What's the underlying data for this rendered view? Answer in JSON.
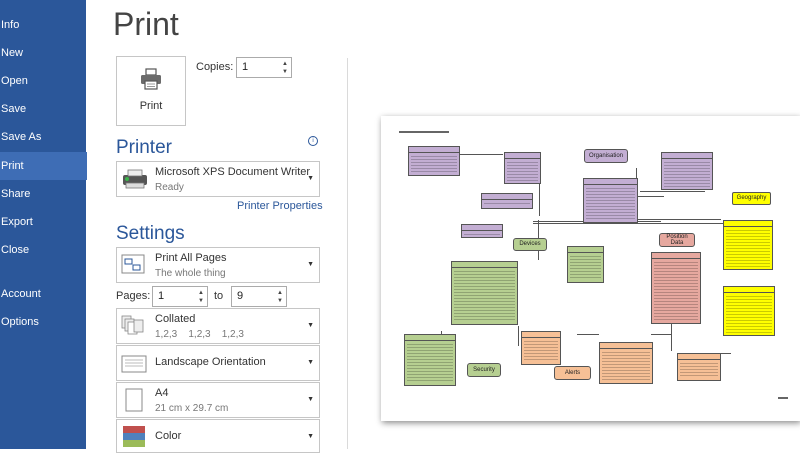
{
  "sidebar": {
    "items": [
      {
        "label": "Info"
      },
      {
        "label": "New"
      },
      {
        "label": "Open"
      },
      {
        "label": "Save"
      },
      {
        "label": "Save As"
      },
      {
        "label": "Print",
        "active": true
      },
      {
        "label": "Share"
      },
      {
        "label": "Export"
      },
      {
        "label": "Close"
      },
      {
        "label": "Account"
      },
      {
        "label": "Options"
      }
    ]
  },
  "page": {
    "title": "Print"
  },
  "print_button": {
    "label": "Print"
  },
  "copies": {
    "label": "Copies:",
    "value": "1"
  },
  "printer": {
    "heading": "Printer",
    "name": "Microsoft XPS Document Writer",
    "status": "Ready",
    "properties_link": "Printer Properties"
  },
  "settings": {
    "heading": "Settings",
    "print_range": {
      "title": "Print All Pages",
      "subtitle": "The whole thing"
    },
    "pages": {
      "label": "Pages:",
      "from": "1",
      "to_label": "to",
      "to": "9"
    },
    "collation": {
      "title": "Collated",
      "subtitle": "1,2,3    1,2,3    1,2,3"
    },
    "orientation": {
      "title": "Landscape Orientation"
    },
    "paper": {
      "title": "A4",
      "subtitle": "21 cm x 29.7 cm"
    },
    "color": {
      "title": "Color"
    }
  },
  "preview": {
    "labels": {
      "organisation": "Organisation",
      "geography": "Geography",
      "position_data": "Position Data",
      "devices": "Devices",
      "security": "Security",
      "alerts": "Alerts"
    }
  },
  "colors": {
    "accent": "#2b579a",
    "purple": "#c3aed3",
    "yellow": "#ffff00",
    "green": "#b6cf91",
    "salmon": "#e6a89f",
    "orange": "#f6c096"
  }
}
